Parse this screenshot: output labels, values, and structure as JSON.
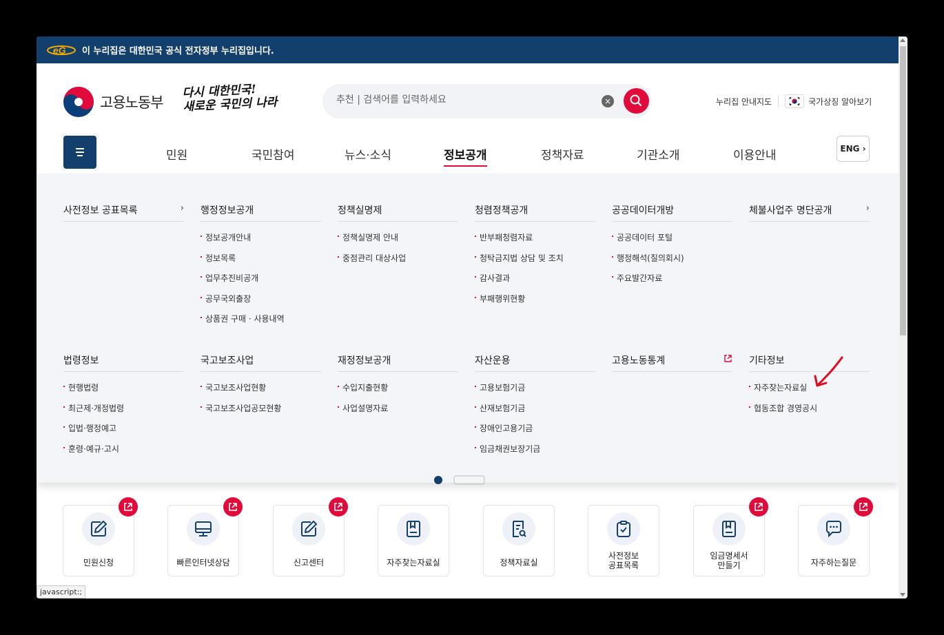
{
  "gov_banner": {
    "text": "이 누리집은 대한민국 공식 전자정부 누리집입니다."
  },
  "logo": {
    "text": "고용노동부"
  },
  "slogan": {
    "line1": "다시 대한민국!",
    "line2": "새로운 국민의 나라"
  },
  "search": {
    "placeholder": "추천 | 검색어를 입력하세요"
  },
  "util": {
    "sitemap": "누리집 안내지도",
    "symbol": "국가상징 알아보기"
  },
  "gnb": {
    "items": [
      "민원",
      "국민참여",
      "뉴스·소식",
      "정보공개",
      "정책자료",
      "기관소개",
      "이용안내"
    ],
    "active": "정보공개",
    "eng": "ENG"
  },
  "mega": {
    "columns": [
      {
        "title": "사전정보 공표목록",
        "items": []
      },
      {
        "title": "행정정보공개",
        "items": [
          "정보공개안내",
          "정보목록",
          "업무추진비공개",
          "공무국외출장",
          "상품권 구매 · 사용내역"
        ]
      },
      {
        "title": "정책실명제",
        "items": [
          "정책실명제 안내",
          "중점관리 대상사업"
        ]
      },
      {
        "title": "청렴정책공개",
        "items": [
          "반부패청렴자료",
          "청탁금지법 상담 및 조치",
          "감사결과",
          "부패행위현황"
        ]
      },
      {
        "title": "공공데이터개방",
        "items": [
          "공공데이터 포털",
          "행정해석(질의회시)",
          "주요발간자료"
        ]
      },
      {
        "title": "체불사업주 명단공개",
        "items": []
      },
      {
        "title": "법령정보",
        "items": [
          "현행법령",
          "최근제·개정법령",
          "입법·행정예고",
          "훈령·예규·고시"
        ]
      },
      {
        "title": "국고보조사업",
        "items": [
          "국고보조사업현황",
          "국고보조사업공모현황"
        ]
      },
      {
        "title": "재정정보공개",
        "items": [
          "수입지출현황",
          "사업설명자료"
        ]
      },
      {
        "title": "자산운용",
        "items": [
          "고용보험기금",
          "산재보험기금",
          "장애인고용기금",
          "임금채권보장기금"
        ]
      },
      {
        "title": "고용노동통계",
        "items": []
      },
      {
        "title": "기타정보",
        "items": [
          "자주찾는자료실",
          "협동조합 경영공시"
        ]
      }
    ]
  },
  "quick": [
    {
      "line1": "민원신청",
      "line2": ""
    },
    {
      "line1": "빠른인터넷상담",
      "line2": ""
    },
    {
      "line1": "신고센터",
      "line2": ""
    },
    {
      "line1": "자주찾는자료실",
      "line2": ""
    },
    {
      "line1": "정책자료실",
      "line2": ""
    },
    {
      "line1": "사전정보",
      "line2": "공표목록"
    },
    {
      "line1": "임금명세서",
      "line2": "만들기"
    },
    {
      "line1": "자주하는질문",
      "line2": ""
    }
  ],
  "status_bar": "javascript:;",
  "colors": {
    "navy": "#123f6b",
    "accent": "#e00a3b"
  }
}
